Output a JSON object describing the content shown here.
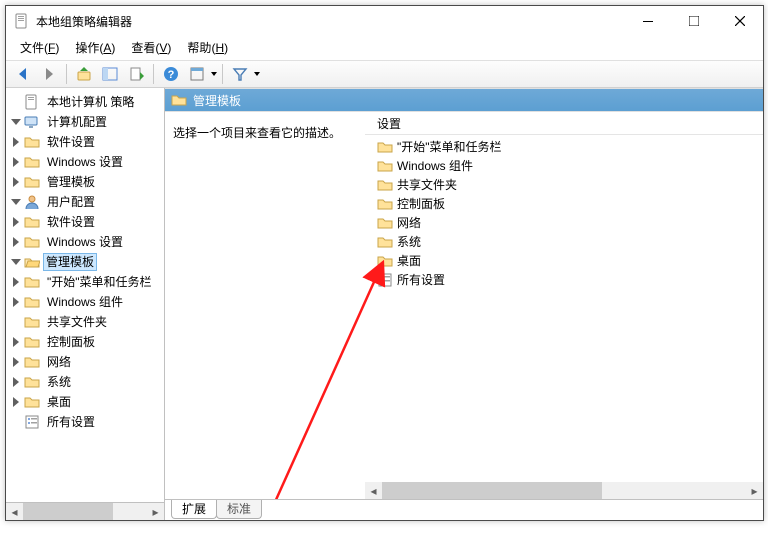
{
  "window": {
    "title": "本地组策略编辑器"
  },
  "menu": {
    "file": "文件",
    "file_key": "F",
    "action": "操作",
    "action_key": "A",
    "view": "查看",
    "view_key": "V",
    "help": "帮助",
    "help_key": "H"
  },
  "tree": {
    "root": "本地计算机 策略",
    "computer": "计算机配置",
    "user": "用户配置",
    "sw": "软件设置",
    "winset": "Windows 设置",
    "admtpl": "管理模板",
    "start_tb": "\"开始\"菜单和任务栏",
    "wincomp": "Windows 组件",
    "shared": "共享文件夹",
    "cp": "控制面板",
    "net": "网络",
    "sys": "系统",
    "desk": "桌面",
    "allset": "所有设置"
  },
  "right": {
    "header": "管理模板",
    "hint": "选择一个项目来查看它的描述。",
    "col_settings": "设置",
    "items": {
      "start_tb": "\"开始\"菜单和任务栏",
      "wincomp": "Windows 组件",
      "shared": "共享文件夹",
      "cp": "控制面板",
      "net": "网络",
      "sys": "系统",
      "desk": "桌面",
      "allset": "所有设置"
    }
  },
  "tabs": {
    "extended": "扩展",
    "standard": "标准"
  }
}
